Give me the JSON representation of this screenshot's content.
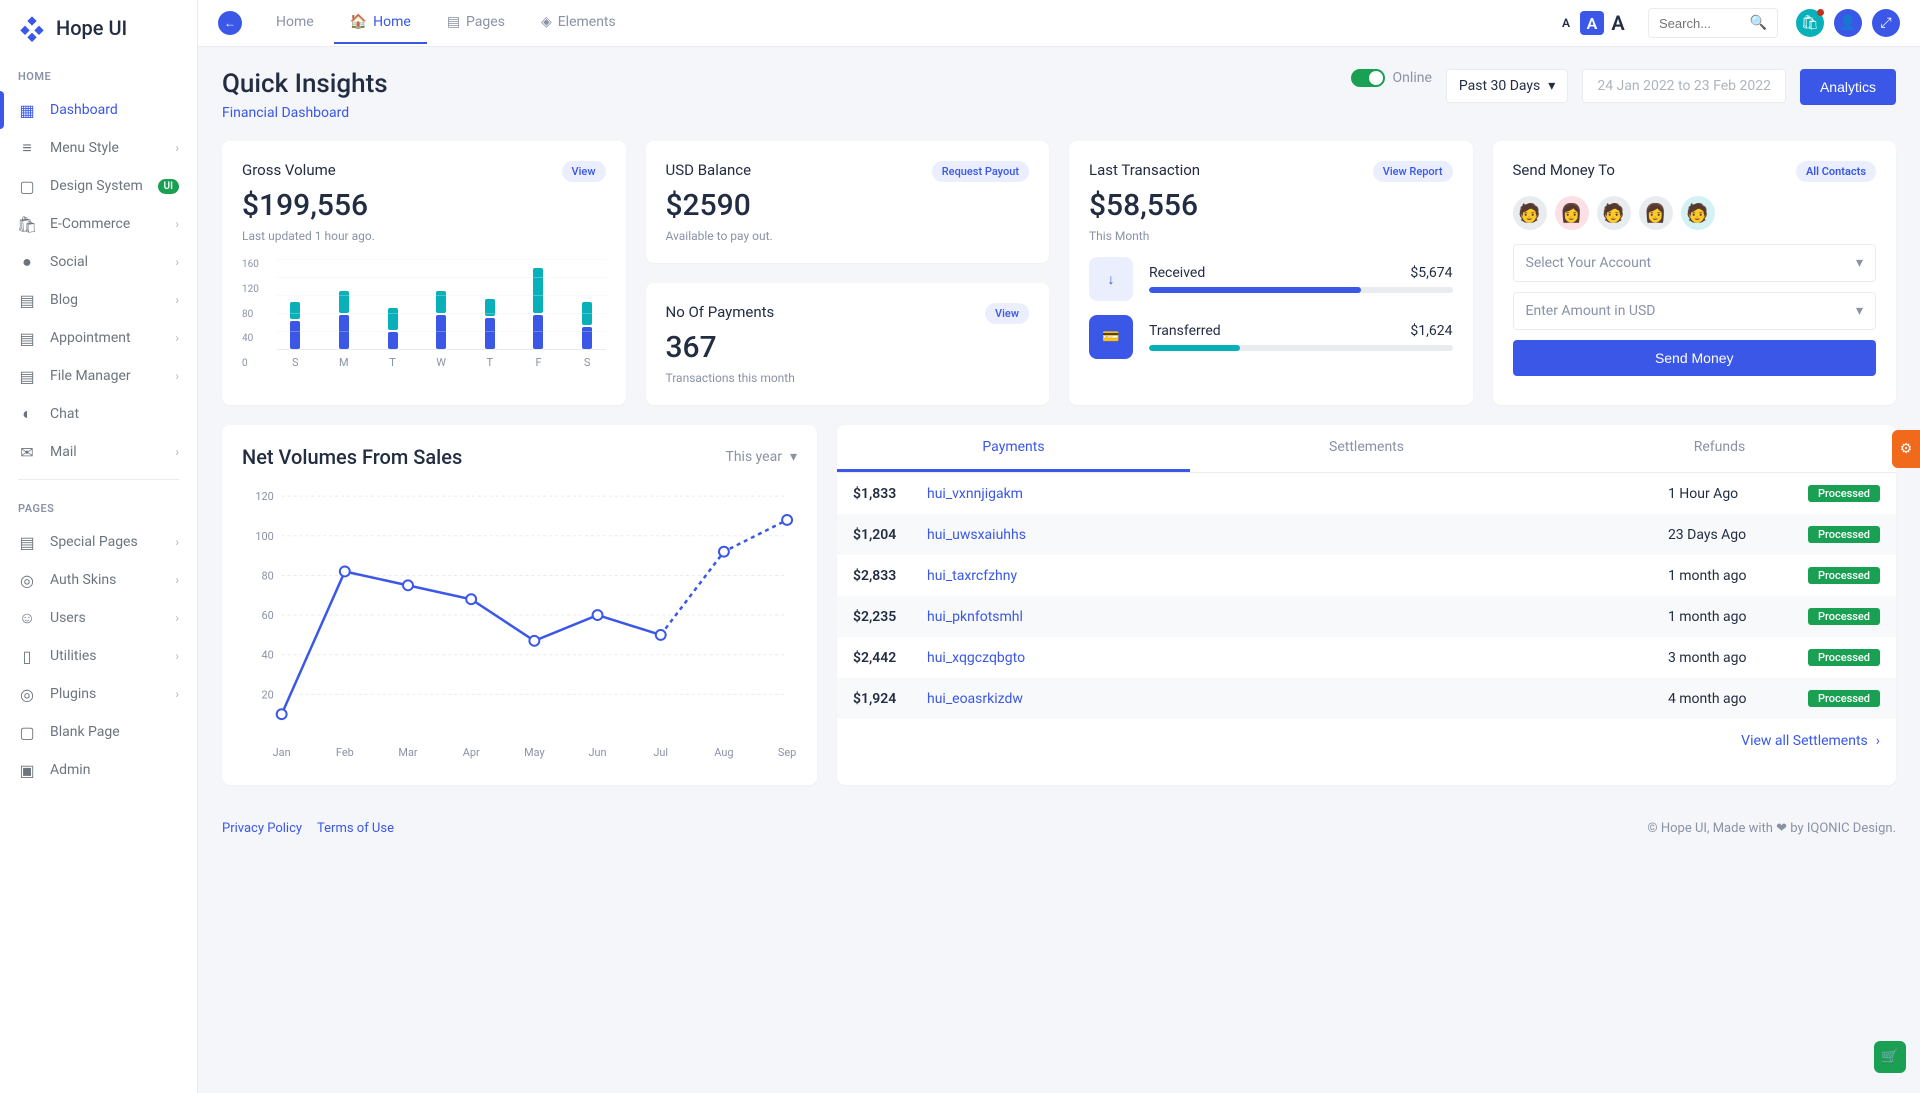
{
  "brand": "Hope UI",
  "topnav": {
    "back": "←",
    "items": [
      {
        "label": "Home",
        "active": false
      },
      {
        "label": "Home",
        "active": true
      },
      {
        "label": "Pages",
        "active": false
      },
      {
        "label": "Elements",
        "active": false
      }
    ],
    "search_placeholder": "Search..."
  },
  "sidebar": {
    "section1": "HOME",
    "section2": "PAGES",
    "items1": [
      {
        "label": "Dashboard",
        "icon": "▦",
        "active": true
      },
      {
        "label": "Menu Style",
        "icon": "≡",
        "chev": true
      },
      {
        "label": "Design System",
        "icon": "▢",
        "badge": "UI"
      },
      {
        "label": "E-Commerce",
        "icon": "🛍",
        "chev": true
      },
      {
        "label": "Social",
        "icon": "●",
        "chev": true
      },
      {
        "label": "Blog",
        "icon": "▤",
        "chev": true
      },
      {
        "label": "Appointment",
        "icon": "▤",
        "chev": true
      },
      {
        "label": "File Manager",
        "icon": "▤",
        "chev": true
      },
      {
        "label": "Chat",
        "icon": "◐"
      },
      {
        "label": "Mail",
        "icon": "✉",
        "chev": true
      }
    ],
    "items2": [
      {
        "label": "Special Pages",
        "icon": "▤",
        "chev": true
      },
      {
        "label": "Auth Skins",
        "icon": "◎",
        "chev": true
      },
      {
        "label": "Users",
        "icon": "☺",
        "chev": true
      },
      {
        "label": "Utilities",
        "icon": "▯",
        "chev": true
      },
      {
        "label": "Plugins",
        "icon": "◎",
        "chev": true
      },
      {
        "label": "Blank Page",
        "icon": "▢"
      },
      {
        "label": "Admin",
        "icon": "▣"
      }
    ]
  },
  "title": "Quick Insights",
  "subtitle": "Financial Dashboard",
  "online": "Online",
  "period": "Past 30 Days",
  "date_range": "24 Jan 2022 to 23 Feb 2022",
  "analytics_btn": "Analytics",
  "cards": {
    "gross": {
      "title": "Gross Volume",
      "pill": "View",
      "value": "$199,556",
      "sub": "Last updated 1 hour ago."
    },
    "usd": {
      "title": "USD Balance",
      "pill": "Request Payout",
      "value": "$2590",
      "sub": "Available to pay out."
    },
    "payments": {
      "title": "No Of Payments",
      "pill": "View",
      "value": "367",
      "sub": "Transactions this month"
    },
    "last_tx": {
      "title": "Last Transaction",
      "pill": "View Report",
      "value": "$58,556",
      "sub": "This Month"
    },
    "received": {
      "label": "Received",
      "amount": "$5,674",
      "pct": 70,
      "color": "#3a57e8"
    },
    "transferred": {
      "label": "Transferred",
      "amount": "$1,624",
      "pct": 30,
      "color": "#08b1ba"
    },
    "send": {
      "title": "Send Money To",
      "pill": "All Contacts",
      "select_account": "Select Your Account",
      "enter_amount": "Enter Amount in USD",
      "btn": "Send Money"
    }
  },
  "chart_data": [
    {
      "type": "bar",
      "title": "Gross Volume weekly",
      "categories": [
        "S",
        "M",
        "T",
        "W",
        "T",
        "F",
        "S"
      ],
      "series": [
        {
          "name": "bottom",
          "color": "#3a57e8",
          "values": [
            50,
            60,
            30,
            60,
            55,
            60,
            40
          ]
        },
        {
          "name": "top",
          "color": "#08b1ba",
          "values": [
            30,
            40,
            40,
            40,
            30,
            80,
            40
          ]
        }
      ],
      "ylim": [
        0,
        160
      ],
      "yticks": [
        0,
        40,
        80,
        120,
        160
      ]
    },
    {
      "type": "line",
      "title": "Net Volumes From Sales",
      "categories": [
        "Jan",
        "Feb",
        "Mar",
        "Apr",
        "May",
        "Jun",
        "Jul",
        "Aug",
        "Sep"
      ],
      "series": [
        {
          "name": "sales",
          "color": "#3a57e8",
          "values": [
            10,
            82,
            75,
            68,
            47,
            60,
            50,
            92,
            108
          ],
          "dashed_from_index": 6
        }
      ],
      "ylim": [
        0,
        120
      ],
      "yticks": [
        20,
        40,
        60,
        80,
        100,
        120
      ],
      "period": "This year"
    }
  ],
  "net_volumes_title": "Net Volumes From Sales",
  "tabs": [
    "Payments",
    "Settlements",
    "Refunds"
  ],
  "payments": [
    {
      "amount": "$1,833",
      "ref": "hui_vxnnjigakm",
      "time": "1 Hour Ago",
      "status": "Processed"
    },
    {
      "amount": "$1,204",
      "ref": "hui_uwsxaiuhhs",
      "time": "23 Days Ago",
      "status": "Processed"
    },
    {
      "amount": "$2,833",
      "ref": "hui_taxrcfzhny",
      "time": "1 month ago",
      "status": "Processed"
    },
    {
      "amount": "$2,235",
      "ref": "hui_pknfotsmhl",
      "time": "1 month ago",
      "status": "Processed"
    },
    {
      "amount": "$2,442",
      "ref": "hui_xqgczqbgto",
      "time": "3 month ago",
      "status": "Processed"
    },
    {
      "amount": "$1,924",
      "ref": "hui_eoasrkizdw",
      "time": "4 month ago",
      "status": "Processed"
    }
  ],
  "view_all": "View all Settlements",
  "footer": {
    "privacy": "Privacy Policy",
    "terms": "Terms of Use",
    "credit1": "© Hope UI, Made with ",
    "credit2": " by IQONIC Design."
  }
}
